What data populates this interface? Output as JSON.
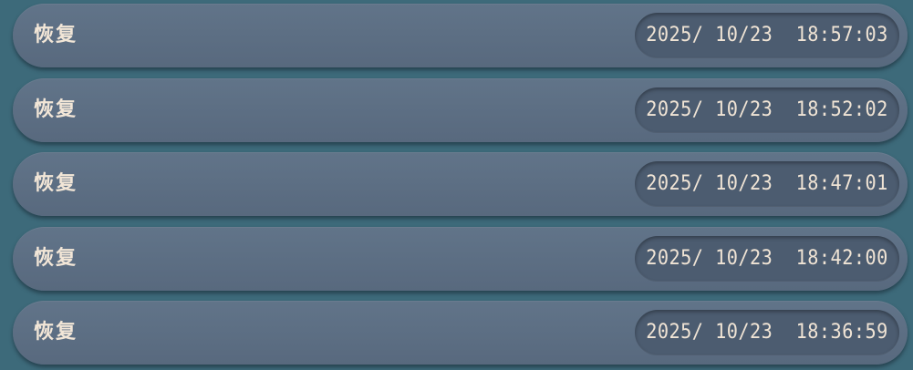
{
  "records": [
    {
      "label": "恢复",
      "timestamp": "2025/ 10/23  18:57:03"
    },
    {
      "label": "恢复",
      "timestamp": "2025/ 10/23  18:52:02"
    },
    {
      "label": "恢复",
      "timestamp": "2025/ 10/23  18:47:01"
    },
    {
      "label": "恢复",
      "timestamp": "2025/ 10/23  18:42:00"
    },
    {
      "label": "恢复",
      "timestamp": "2025/ 10/23  18:36:59"
    }
  ]
}
